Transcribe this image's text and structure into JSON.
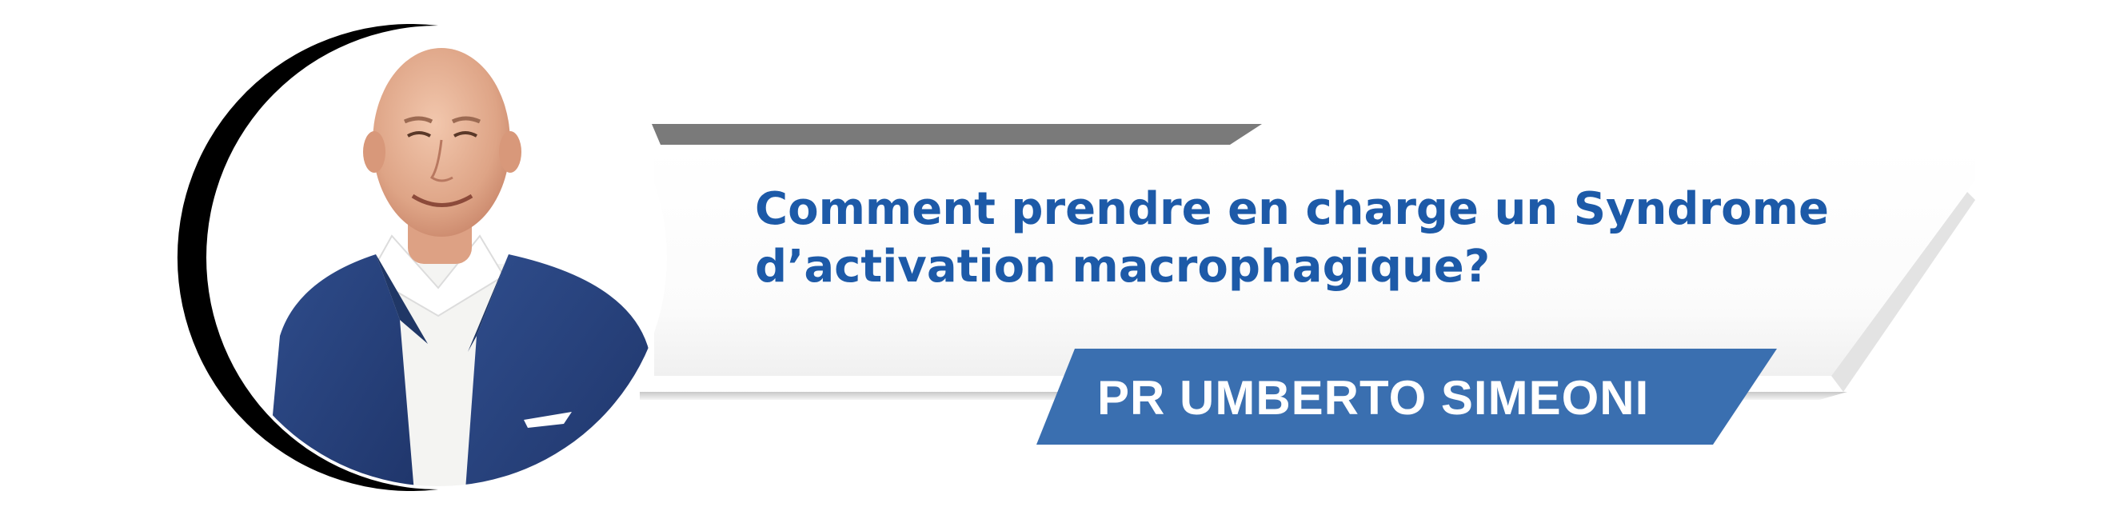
{
  "banner": {
    "title_line_1": "Comment prendre en charge un Syndrome",
    "title_line_2": "d’activation macrophagique?",
    "speaker_name": "PR UMBERTO SIMEONI"
  },
  "colors": {
    "title_blue": "#1d5aa8",
    "name_band_blue": "#3a6fb0",
    "top_bar_gray": "#7a7a7a",
    "ring_black": "#000000",
    "suit_navy": "#26407a"
  }
}
